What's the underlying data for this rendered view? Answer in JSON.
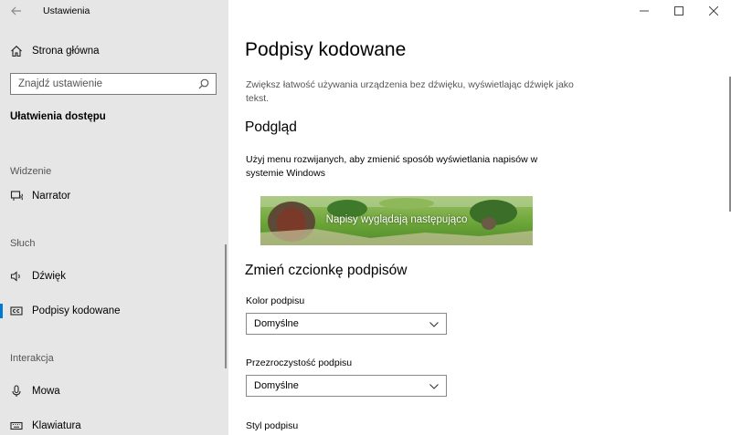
{
  "window": {
    "app_title": "Ustawienia",
    "back_icon": "back-arrow-icon",
    "controls": {
      "minimize": "—",
      "maximize": "☐",
      "close": "✕"
    }
  },
  "sidebar": {
    "home_label": "Strona główna",
    "search": {
      "placeholder": "Znajdź ustawienie"
    },
    "category_title": "Ułatwienia dostępu",
    "sections": {
      "vision": "Widzenie",
      "hearing": "Słuch",
      "interaction": "Interakcja"
    },
    "items": {
      "narrator": "Narrator",
      "audio": "Dźwięk",
      "captions": "Podpisy kodowane",
      "speech": "Mowa",
      "keyboard": "Klawiatura"
    },
    "accent_color": "#0078d4"
  },
  "main": {
    "title": "Podpisy kodowane",
    "description": "Zwiększ łatwość używania urządzenia bez dźwięku, wyświetlając dźwięk jako tekst.",
    "preview_heading": "Podgląd",
    "preview_text": "Użyj menu rozwijanych, aby zmienić sposób wyświetlania napisów w systemie Windows",
    "preview_caption": "Napisy wyglądają następująco",
    "font_heading": "Zmień czcionkę podpisów",
    "fields": {
      "color": {
        "label": "Kolor podpisu",
        "value": "Domyślne"
      },
      "transparency": {
        "label": "Przezroczystość podpisu",
        "value": "Domyślne"
      },
      "style": {
        "label": "Styl podpisu"
      }
    }
  }
}
